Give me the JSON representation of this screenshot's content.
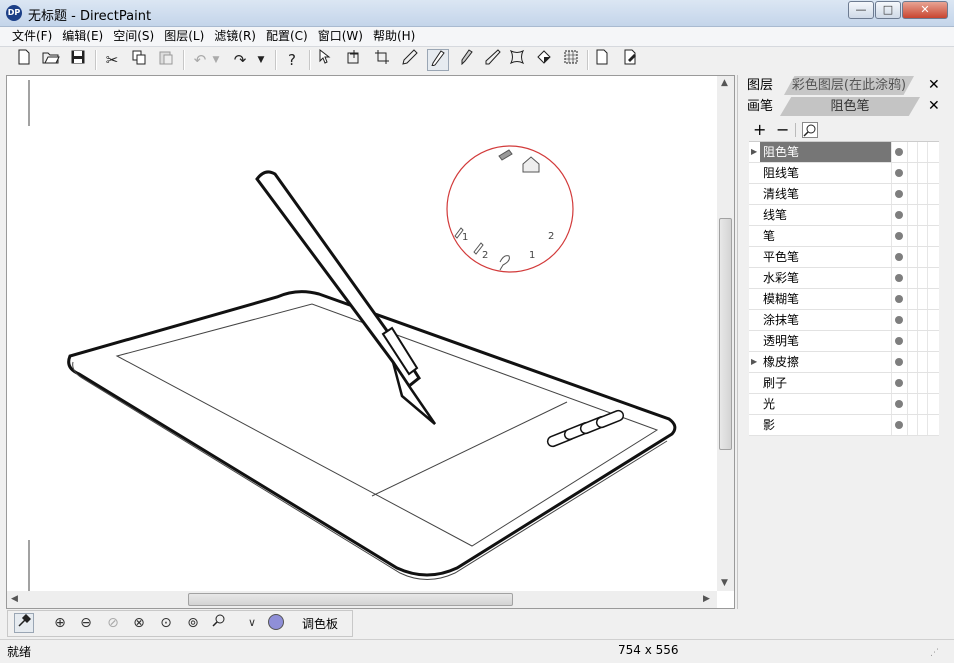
{
  "window": {
    "title": "无标题 - DirectPaint",
    "app_icon": "DP",
    "controls": {
      "minimize": "—",
      "maximize": "□",
      "close": "✕"
    }
  },
  "menu": [
    {
      "label": "文件(F)"
    },
    {
      "label": "编辑(E)"
    },
    {
      "label": "空间(S)"
    },
    {
      "label": "图层(L)"
    },
    {
      "label": "滤镜(R)"
    },
    {
      "label": "配置(C)"
    },
    {
      "label": "窗口(W)"
    },
    {
      "label": "帮助(H)"
    }
  ],
  "toolbar_icons": {
    "new": "new-document-icon",
    "open": "open-folder-icon",
    "save": "save-icon",
    "cut": "cut-icon",
    "copy": "copy-icon",
    "paste": "paste-icon",
    "undo": "undo-icon",
    "redo": "redo-icon",
    "help": "help-icon",
    "select": "select-arrow-icon",
    "move": "move-icon",
    "crop": "crop-icon",
    "pen": "pen-icon"
  },
  "panel": {
    "layers_tab": "图层",
    "color_layer_tab": "彩色图层(在此涂鸦)",
    "brush_tab": "画笔",
    "brush_current": "阻色笔",
    "close_label": "✕"
  },
  "brushes": [
    {
      "name": "阻色笔",
      "expandable": true,
      "selected": true
    },
    {
      "name": "阻线笔"
    },
    {
      "name": "清线笔"
    },
    {
      "name": "线笔"
    },
    {
      "name": "笔"
    },
    {
      "name": "平色笔"
    },
    {
      "name": "水彩笔"
    },
    {
      "name": "模糊笔"
    },
    {
      "name": "涂抹笔"
    },
    {
      "name": "透明笔"
    },
    {
      "name": "橡皮擦",
      "expandable": true
    },
    {
      "name": "刷子"
    },
    {
      "name": "光"
    },
    {
      "name": "影"
    }
  ],
  "bottom_toolbar": {
    "palette_label": "调色板",
    "color_swatch": "#8f8fd8"
  },
  "canvas": {
    "pie_labels": [
      "1",
      "2",
      "1",
      "2"
    ]
  },
  "status": {
    "text": "就绪",
    "dimensions": "754 x 556"
  }
}
